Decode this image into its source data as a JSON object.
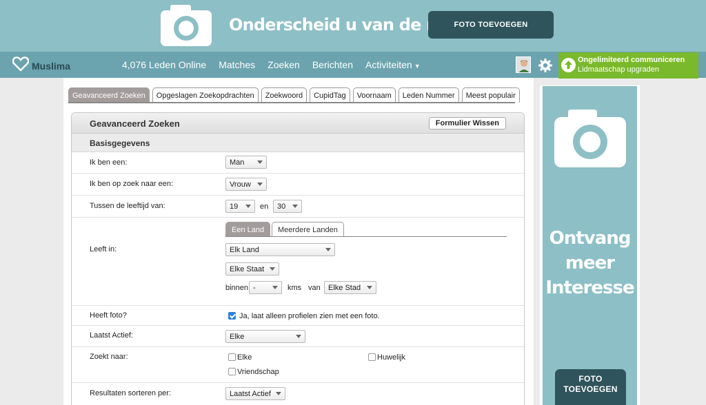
{
  "banner": {
    "slogan": "Onderscheid u van de rest",
    "button_label": "FOTO TOEVOEGEN",
    "camera_icon": "camera-icon"
  },
  "nav": {
    "logo_text": "Muslima",
    "members_online": "4,076 Leden Online",
    "links": [
      "Matches",
      "Zoeken",
      "Berichten",
      "Activiteiten"
    ],
    "upgrade_line1": "Ongelimiteerd communiceren",
    "upgrade_line2": "Lidmaatschap upgraden"
  },
  "tabs": [
    "Geavanceerd Zoeken",
    "Opgeslagen Zoekopdrachten",
    "Zoekwoord",
    "CupidTag",
    "Voornaam",
    "Leden Nummer",
    "Meest populair"
  ],
  "panel": {
    "title": "Geavanceerd Zoeken",
    "clear_button": "Formulier Wissen",
    "section": "Basisgegevens"
  },
  "form": {
    "i_am_label": "Ik ben een:",
    "i_am_value": "Man",
    "seeking_label": "Ik ben op zoek naar een:",
    "seeking_value": "Vrouw",
    "age_label": "Tussen de leeftijd van:",
    "age_from": "19",
    "age_and": "en",
    "age_to": "30",
    "lives_label": "Leeft in:",
    "location_tabs": [
      "Een Land",
      "Meerdere Landen"
    ],
    "country_value": "Elk Land",
    "state_value": "Elke Staat",
    "within_label": "binnen",
    "distance_value": "-",
    "kms_label": "kms",
    "from_label": "van",
    "city_value": "Elke Stad",
    "photo_label": "Heeft foto?",
    "photo_option": "Ja, laat alleen profielen zien met een foto.",
    "photo_checked": true,
    "last_active_label": "Laatst Actief:",
    "last_active_value": "Elke",
    "looking_for_label": "Zoekt naar:",
    "looking_for_options": [
      "Elke",
      "Huwelijk",
      "Vriendschap"
    ],
    "sort_label": "Resultaten sorteren per:",
    "sort_value": "Laatst Actief"
  },
  "ad": {
    "headline_lines": [
      "Ontvang",
      "meer",
      "Interesse"
    ],
    "button_lines": [
      "FOTO",
      "TOEVOEGEN"
    ]
  },
  "colors": {
    "banner_bg": "#8dbfc6",
    "nav_bg": "#6ba3ae",
    "dark_button": "#2f545b",
    "upgrade_green": "#7ab92c",
    "active_tab": "#a29c9a"
  }
}
